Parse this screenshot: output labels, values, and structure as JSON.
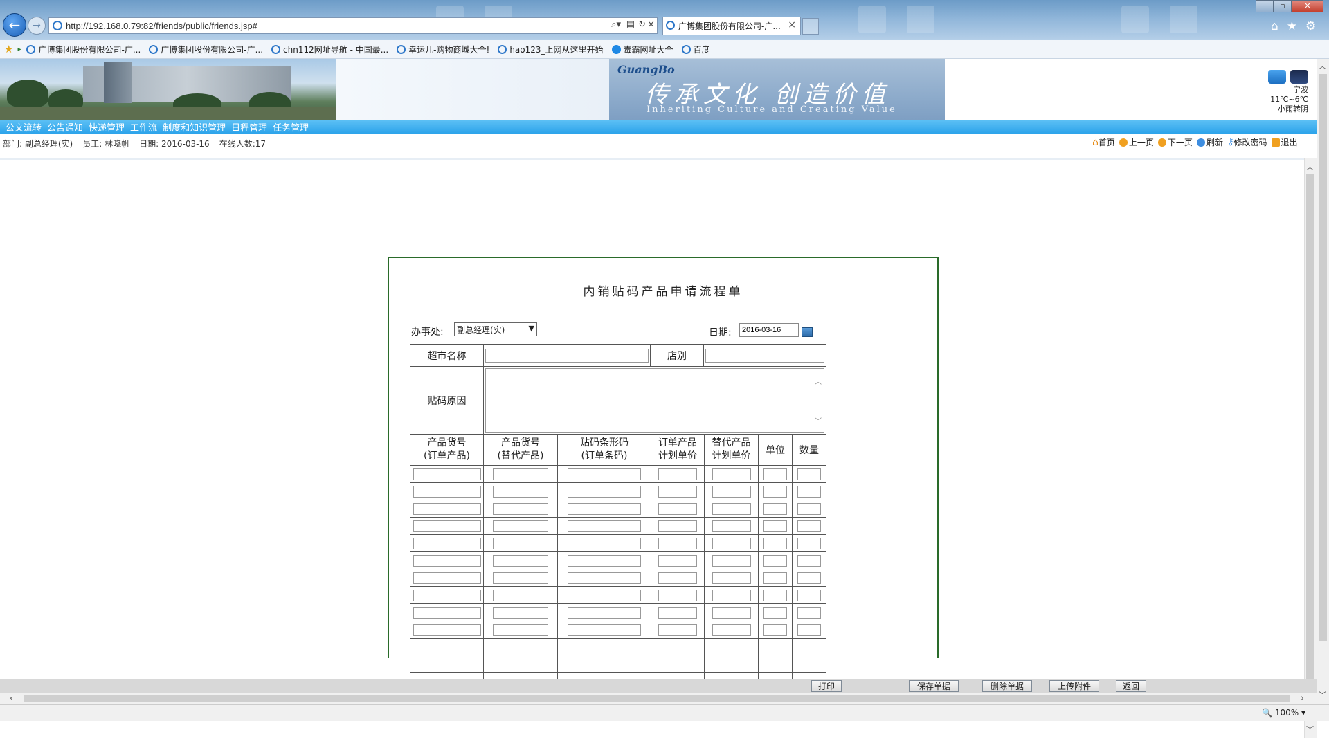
{
  "browser": {
    "url": "http://192.168.0.79:82/friends/public/friends.jsp#",
    "tab_title": "广博集团股份有限公司-广...",
    "zoom": "100%",
    "window_controls": {
      "minimize": "−",
      "maximize": "▫",
      "close": "✕"
    }
  },
  "favorites": [
    {
      "label": "广博集团股份有限公司-广..."
    },
    {
      "label": "广博集团股份有限公司-广..."
    },
    {
      "label": "chn112网址导航 - 中国最..."
    },
    {
      "label": "幸运儿-购物商城大全!"
    },
    {
      "label": "hao123_上网从这里开始"
    },
    {
      "label": "毒霸网址大全"
    },
    {
      "label": "百度"
    }
  ],
  "banner": {
    "logo": "GuangBo",
    "slogan_cn": "传承文化 创造价值",
    "slogan_en": "Inheriting Culture and Creating Value"
  },
  "weather": {
    "city": "宁波",
    "temp": "11℃~6℃",
    "desc": "小雨转阴"
  },
  "menu": [
    "公文流转",
    "公告通知",
    "快递管理",
    "工作流",
    "制度和知识管理",
    "日程管理",
    "任务管理"
  ],
  "info": {
    "dept": "部门: 副总经理(实)",
    "staff": "员工: 林晓帆",
    "date": "日期: 2016-03-16",
    "online": "在线人数:17"
  },
  "toolbar": {
    "home": "首页",
    "prev": "上一页",
    "next": "下一页",
    "refresh": "刷新",
    "password": "修改密码",
    "logout": "退出"
  },
  "form": {
    "title": "内销贴码产品申请流程单",
    "office_label": "办事处:",
    "office_value": "副总经理(实)",
    "date_label": "日期:",
    "date_value": "2016-03-16",
    "supermarket_label": "超市名称",
    "store_label": "店别",
    "reason_label": "贴码原因",
    "columns": [
      "产品货号\n(订单产品)",
      "产品货号\n(替代产品)",
      "贴码条形码\n(订单条码)",
      "订单产品\n计划单价",
      "替代产品\n计划单价",
      "单位",
      "数量"
    ]
  },
  "bottom_buttons": {
    "print": "打印",
    "save": "保存单据",
    "delete": "删除单据",
    "upload": "上传附件",
    "back": "返回"
  }
}
